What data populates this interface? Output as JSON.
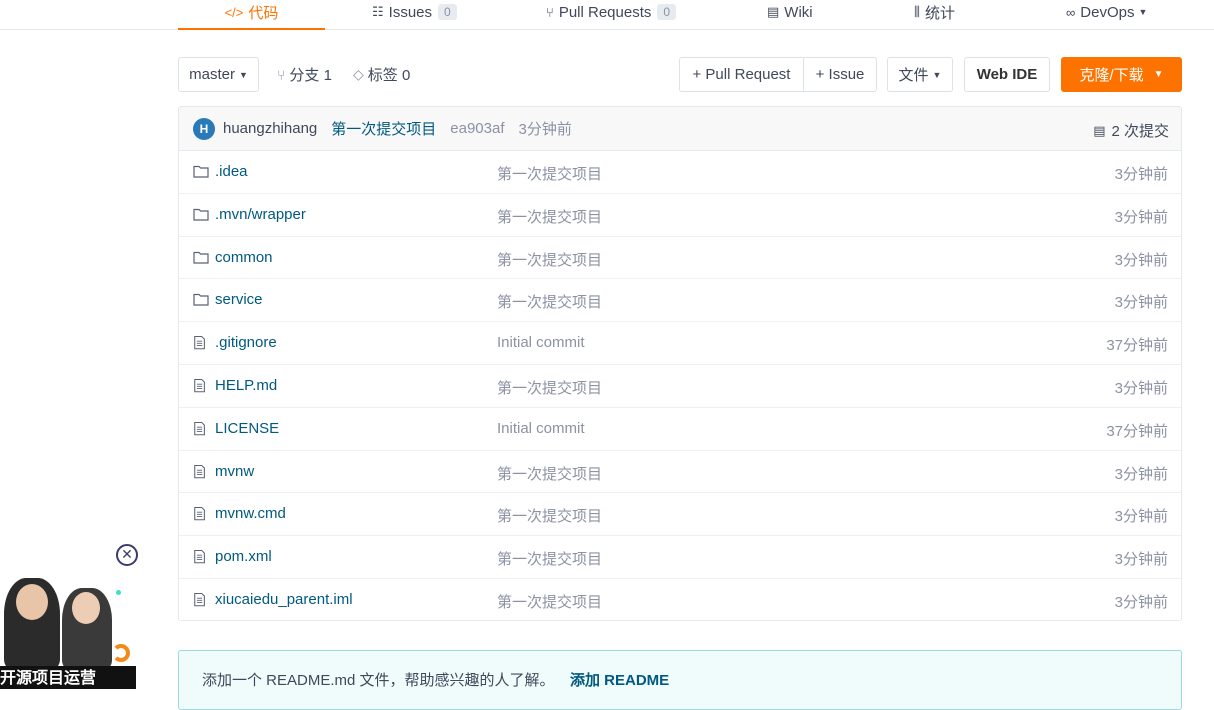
{
  "nav": {
    "tabs": [
      {
        "label": "代码",
        "icon": "code-icon",
        "active": true
      },
      {
        "label": "Issues",
        "icon": "issues-icon",
        "count": "0"
      },
      {
        "label": "Pull Requests",
        "icon": "pull-request-icon",
        "count": "0"
      },
      {
        "label": "Wiki",
        "icon": "book-icon"
      },
      {
        "label": "统计",
        "icon": "bar-chart-icon"
      },
      {
        "label": "DevOps",
        "icon": "infinity-icon"
      }
    ]
  },
  "toolbar": {
    "branch": "master",
    "branches": "分支 1",
    "tags": "标签 0",
    "pull_request": "+ Pull Request",
    "issue": "+ Issue",
    "files": "文件",
    "web_ide": "Web IDE",
    "clone": "克隆/下载"
  },
  "commit": {
    "avatar_letter": "H",
    "author": "huangzhihang",
    "message": "第一次提交项目",
    "sha": "ea903af",
    "time": "3分钟前",
    "count": "2 次提交"
  },
  "files": [
    {
      "name": ".idea",
      "type": "folder",
      "message": "第一次提交项目",
      "time": "3分钟前"
    },
    {
      "name": ".mvn/wrapper",
      "type": "folder",
      "message": "第一次提交项目",
      "time": "3分钟前"
    },
    {
      "name": "common",
      "type": "folder",
      "message": "第一次提交项目",
      "time": "3分钟前"
    },
    {
      "name": "service",
      "type": "folder",
      "message": "第一次提交项目",
      "time": "3分钟前"
    },
    {
      "name": ".gitignore",
      "type": "file",
      "message": "Initial commit",
      "time": "37分钟前"
    },
    {
      "name": "HELP.md",
      "type": "file",
      "message": "第一次提交项目",
      "time": "3分钟前"
    },
    {
      "name": "LICENSE",
      "type": "file",
      "message": "Initial commit",
      "time": "37分钟前"
    },
    {
      "name": "mvnw",
      "type": "file",
      "message": "第一次提交项目",
      "time": "3分钟前"
    },
    {
      "name": "mvnw.cmd",
      "type": "file",
      "message": "第一次提交项目",
      "time": "3分钟前"
    },
    {
      "name": "pom.xml",
      "type": "file",
      "message": "第一次提交项目",
      "time": "3分钟前"
    },
    {
      "name": "xiucaiedu_parent.iml",
      "type": "file",
      "message": "第一次提交项目",
      "time": "3分钟前"
    }
  ],
  "readme": {
    "text": "添加一个 README.md 文件，帮助感兴趣的人了解。",
    "link": "添加 README"
  },
  "widget": {
    "caption": "开源项目运营"
  },
  "colors": {
    "accent": "#fe7300",
    "link": "#005980",
    "muted": "#8c92a4"
  }
}
